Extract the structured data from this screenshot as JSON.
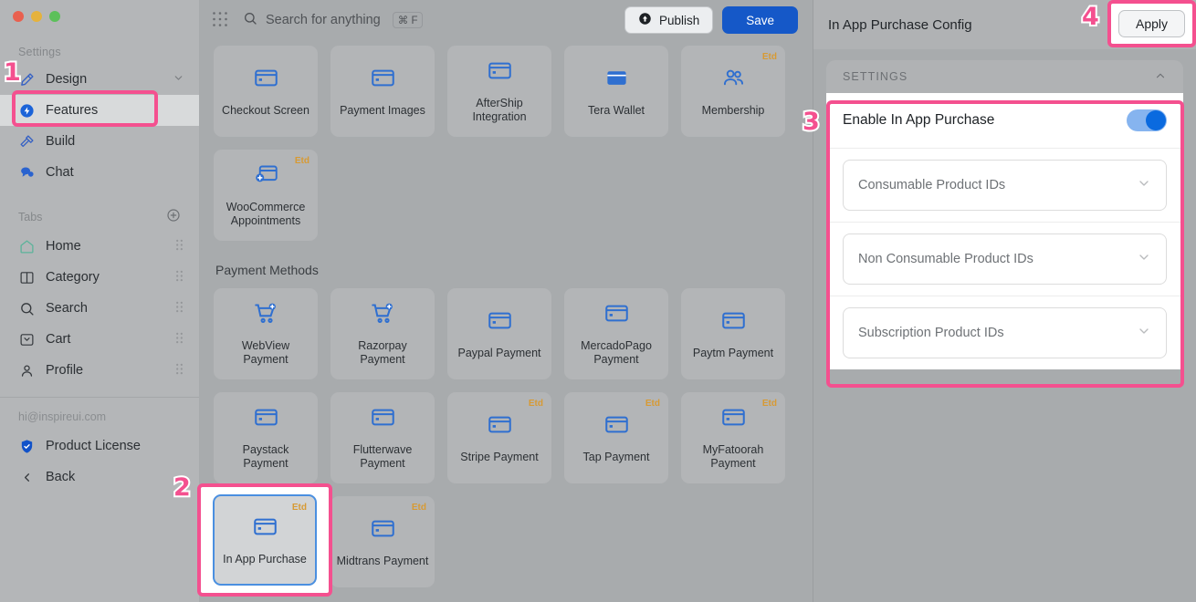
{
  "window": {
    "traffic_lights": [
      "close",
      "minimize",
      "maximize"
    ]
  },
  "sidebar": {
    "settings_label": "Settings",
    "settings_items": [
      {
        "label": "Design",
        "icon": "brush-icon",
        "has_chevron": true
      },
      {
        "label": "Features",
        "icon": "features-icon",
        "has_chevron": false
      },
      {
        "label": "Build",
        "icon": "hammer-icon",
        "has_chevron": false
      },
      {
        "label": "Chat",
        "icon": "chat-icon",
        "has_chevron": false
      }
    ],
    "tabs_label": "Tabs",
    "tabs_add_icon": "plus-circle-icon",
    "tabs_items": [
      {
        "label": "Home",
        "icon": "home-icon"
      },
      {
        "label": "Category",
        "icon": "category-icon"
      },
      {
        "label": "Search",
        "icon": "search-icon"
      },
      {
        "label": "Cart",
        "icon": "cart-icon"
      },
      {
        "label": "Profile",
        "icon": "person-icon"
      }
    ],
    "account_email": "hi@inspireui.com",
    "footer_items": [
      {
        "label": "Product License",
        "icon": "shield-check-icon"
      },
      {
        "label": "Back",
        "icon": "chevron-left-icon"
      }
    ]
  },
  "topbar": {
    "apps_icon": "grid-apps-icon",
    "search_icon": "search-icon",
    "search_placeholder": "Search for anything",
    "search_shortcut": "⌘ F",
    "publish_label": "Publish",
    "publish_icon": "upload-circle-icon",
    "save_label": "Save"
  },
  "main": {
    "badge_text": "Etd",
    "top_tiles": [
      {
        "label": "Checkout Screen",
        "icon": "card-icon",
        "badge": ""
      },
      {
        "label": "Payment Images",
        "icon": "card-icon",
        "badge": ""
      },
      {
        "label": "AfterShip Integration",
        "icon": "card-icon",
        "badge": ""
      },
      {
        "label": "Tera Wallet",
        "icon": "wallet-icon",
        "badge": ""
      },
      {
        "label": "Membership",
        "icon": "people-icon",
        "badge": "Etd"
      }
    ],
    "second_row_tiles": [
      {
        "label": "WooCommerce Appointments",
        "icon": "appointments-icon",
        "badge": "Etd"
      }
    ],
    "payment_section_title": "Payment Methods",
    "payment_row1": [
      {
        "label": "WebView Payment",
        "icon": "cart-plus-icon",
        "badge": ""
      },
      {
        "label": "Razorpay Payment",
        "icon": "cart-plus-icon",
        "badge": ""
      },
      {
        "label": "Paypal Payment",
        "icon": "card-icon",
        "badge": ""
      },
      {
        "label": "MercadoPago Payment",
        "icon": "card-icon",
        "badge": ""
      },
      {
        "label": "Paytm Payment",
        "icon": "card-icon",
        "badge": ""
      }
    ],
    "payment_row2": [
      {
        "label": "Paystack Payment",
        "icon": "card-icon",
        "badge": ""
      },
      {
        "label": "Flutterwave Payment",
        "icon": "card-icon",
        "badge": ""
      },
      {
        "label": "Stripe Payment",
        "icon": "card-icon",
        "badge": "Etd"
      },
      {
        "label": "Tap Payment",
        "icon": "card-icon",
        "badge": "Etd"
      },
      {
        "label": "MyFatoorah Payment",
        "icon": "card-icon",
        "badge": "Etd"
      }
    ],
    "payment_row3": [
      {
        "label": "In App Purchase",
        "icon": "card-icon",
        "badge": "Etd",
        "selected": true
      },
      {
        "label": "Midtrans Payment",
        "icon": "card-icon",
        "badge": "Etd",
        "selected": false
      }
    ]
  },
  "right_panel": {
    "title": "In App Purchase Config",
    "apply_label": "Apply",
    "card_header": "SETTINGS",
    "collapse_icon": "chevron-up-icon",
    "toggle_label": "Enable In App Purchase",
    "toggle_on": true,
    "selects": [
      {
        "value": "Consumable Product IDs",
        "icon": "chevron-down-icon"
      },
      {
        "value": "Non Consumable Product IDs",
        "icon": "chevron-down-icon"
      },
      {
        "value": "Subscription Product IDs",
        "icon": "chevron-down-icon"
      }
    ]
  },
  "annotations": {
    "accent": "#f4508f",
    "steps": [
      {
        "number": "1"
      },
      {
        "number": "2"
      },
      {
        "number": "3"
      },
      {
        "number": "4"
      }
    ]
  }
}
